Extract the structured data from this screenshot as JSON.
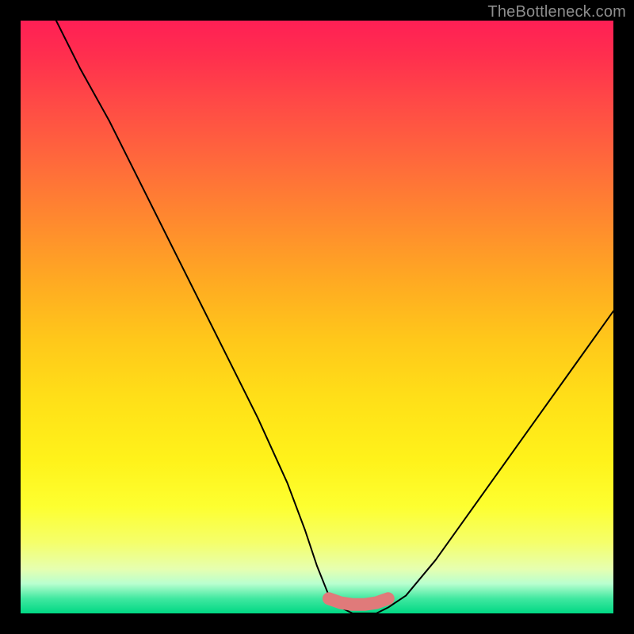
{
  "watermark": "TheBottleneck.com",
  "colors": {
    "frame": "#000000",
    "curve_stroke": "#000000",
    "bump_stroke": "#e07a7a",
    "bump_fill": "#e07a7a",
    "gradient_top": "#ff1f55",
    "gradient_bottom": "#00d884"
  },
  "chart_data": {
    "type": "line",
    "title": "",
    "xlabel": "",
    "ylabel": "",
    "xlim": [
      0,
      100
    ],
    "ylim": [
      0,
      100
    ],
    "grid": false,
    "legend": false,
    "series": [
      {
        "name": "bottleneck-curve",
        "x": [
          6,
          10,
          15,
          20,
          25,
          30,
          35,
          40,
          45,
          48,
          50,
          52,
          54,
          56,
          58,
          60,
          62,
          65,
          70,
          75,
          80,
          85,
          90,
          95,
          100
        ],
        "y": [
          100,
          92,
          83,
          73,
          63,
          53,
          43,
          33,
          22,
          14,
          8,
          3,
          1,
          0,
          0,
          0,
          1,
          3,
          9,
          16,
          23,
          30,
          37,
          44,
          51
        ]
      },
      {
        "name": "optimal-band-marker",
        "x": [
          52,
          54,
          56,
          58,
          60,
          62
        ],
        "y": [
          2.5,
          1.8,
          1.5,
          1.5,
          1.8,
          2.5
        ]
      }
    ],
    "annotations": []
  }
}
